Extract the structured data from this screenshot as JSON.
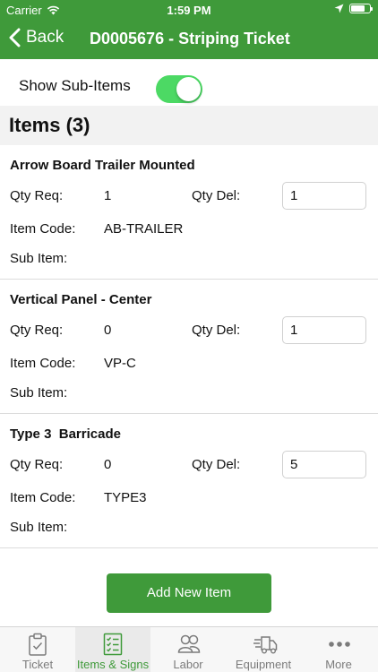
{
  "status_bar": {
    "carrier": "Carrier",
    "time": "1:59 PM"
  },
  "nav": {
    "back_label": "Back",
    "title": "D0005676 - Striping Ticket"
  },
  "toggle": {
    "label": "Show Sub-Items",
    "on": true
  },
  "section": {
    "title": "Items (3)"
  },
  "labels": {
    "qty_req": "Qty Req:",
    "qty_del": "Qty Del:",
    "item_code": "Item Code:",
    "sub_item": "Sub Item:"
  },
  "items": [
    {
      "name": "Arrow Board Trailer Mounted",
      "qty_req": "1",
      "qty_del": "1",
      "item_code": "AB-TRAILER",
      "sub_item": ""
    },
    {
      "name": "Vertical Panel - Center",
      "qty_req": "0",
      "qty_del": "1",
      "item_code": "VP-C",
      "sub_item": ""
    },
    {
      "name": "Type 3  Barricade",
      "qty_req": "0",
      "qty_del": "5",
      "item_code": "TYPE3",
      "sub_item": ""
    }
  ],
  "add_button": {
    "label": "Add New Item"
  },
  "tabs": [
    {
      "label": "Ticket",
      "icon": "clipboard-icon",
      "active": false
    },
    {
      "label": "Items & Signs",
      "icon": "checklist-icon",
      "active": true
    },
    {
      "label": "Labor",
      "icon": "people-icon",
      "active": false
    },
    {
      "label": "Equipment",
      "icon": "truck-icon",
      "active": false
    },
    {
      "label": "More",
      "icon": "more-dots-icon",
      "active": false
    }
  ],
  "colors": {
    "brand_green": "#3f9a3a",
    "switch_on": "#4cd964",
    "tab_inactive": "#7b7b7b"
  }
}
